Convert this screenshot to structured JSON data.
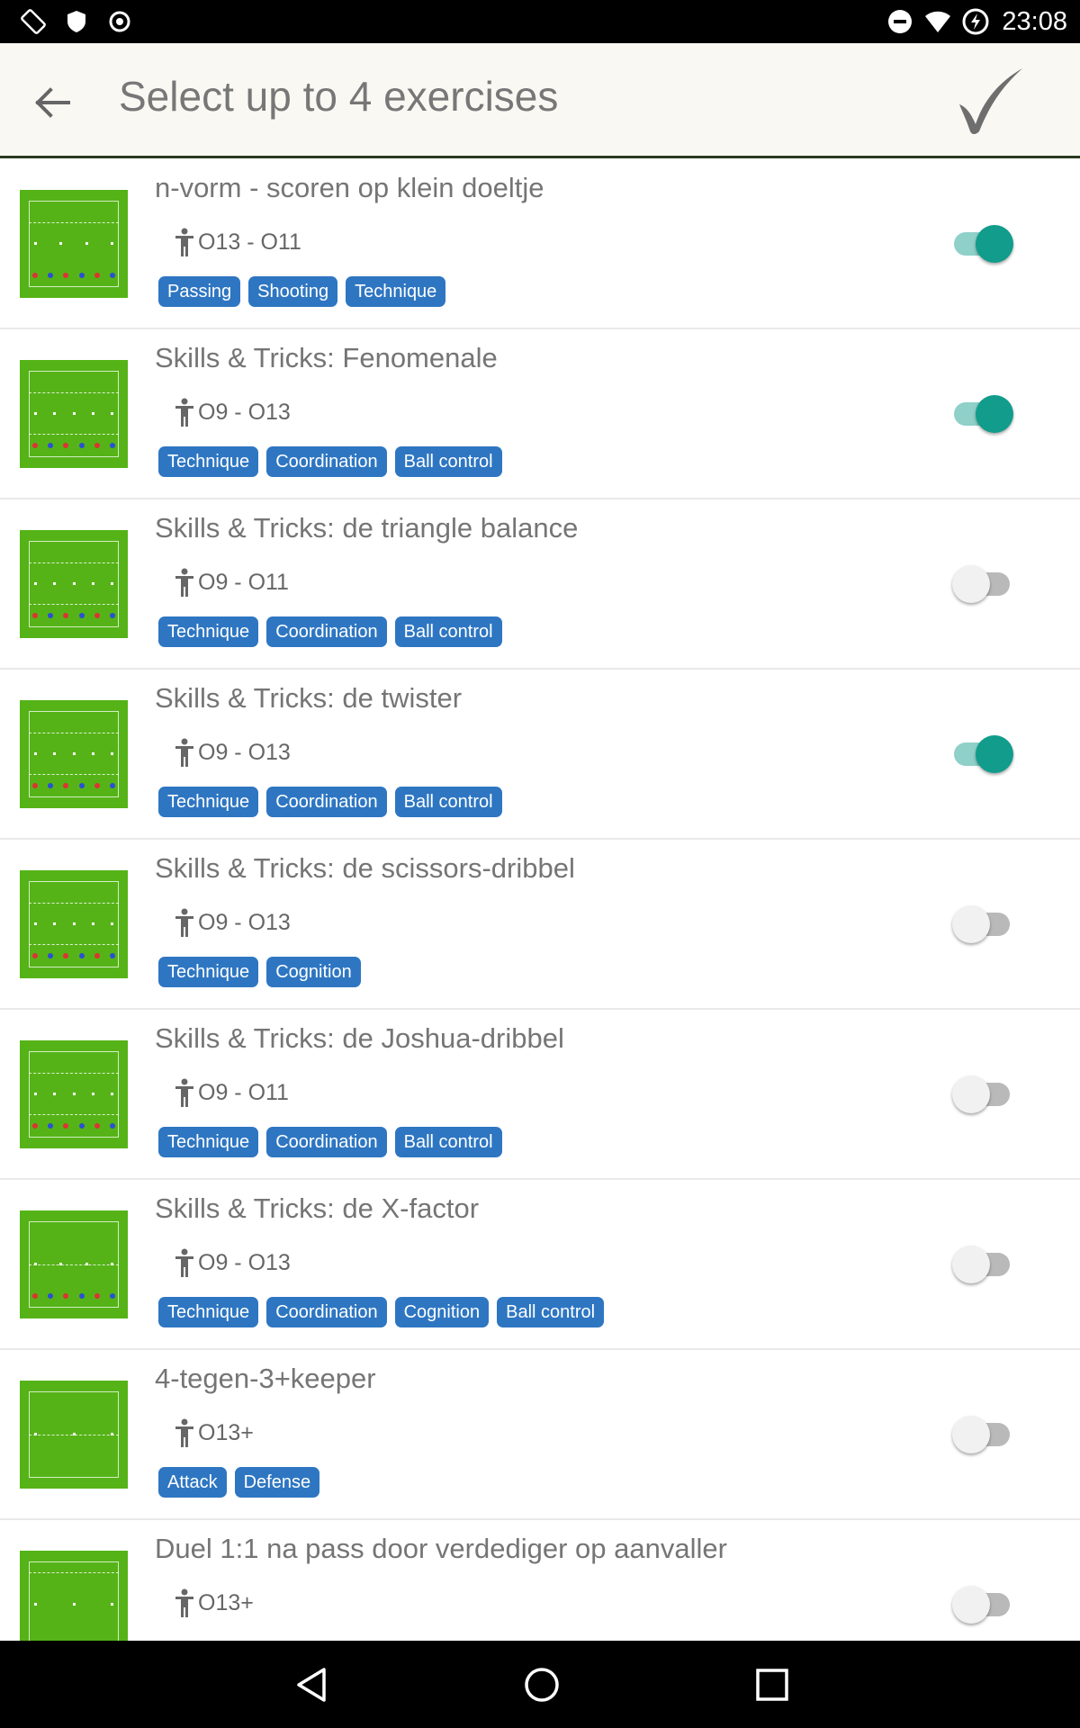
{
  "status_bar": {
    "time": "23:08",
    "icons": [
      "screen-rotation-icon",
      "shield-icon",
      "sync-icon",
      "do-not-disturb-icon",
      "wifi-icon",
      "battery-charging-icon"
    ]
  },
  "app_bar": {
    "title": "Select up to 4 exercises",
    "back_icon": "arrow-back-icon",
    "confirm_icon": "checkmark-icon"
  },
  "colors": {
    "toggle_on": "#119c8c",
    "tag_bg": "#2e76c2",
    "pitch_green": "#55b317"
  },
  "exercises": [
    {
      "title": "n-vorm - scoren op klein doeltje",
      "age": "O13 - O11",
      "tags": [
        "Passing",
        "Shooting",
        "Technique"
      ],
      "selected": true
    },
    {
      "title": "Skills & Tricks: Fenomenale",
      "age": "O9 - O13",
      "tags": [
        "Technique",
        "Coordination",
        "Ball control"
      ],
      "selected": true
    },
    {
      "title": "Skills & Tricks: de triangle balance",
      "age": "O9 - O11",
      "tags": [
        "Technique",
        "Coordination",
        "Ball control"
      ],
      "selected": false
    },
    {
      "title": "Skills & Tricks: de twister",
      "age": "O9 - O13",
      "tags": [
        "Technique",
        "Coordination",
        "Ball control"
      ],
      "selected": true
    },
    {
      "title": "Skills & Tricks: de scissors-dribbel",
      "age": "O9 - O13",
      "tags": [
        "Technique",
        "Cognition"
      ],
      "selected": false
    },
    {
      "title": "Skills & Tricks: de Joshua-dribbel",
      "age": "O9 - O11",
      "tags": [
        "Technique",
        "Coordination",
        "Ball control"
      ],
      "selected": false
    },
    {
      "title": "Skills & Tricks: de X-factor",
      "age": "O9 - O13",
      "tags": [
        "Technique",
        "Coordination",
        "Cognition",
        "Ball control"
      ],
      "selected": false
    },
    {
      "title": "4-tegen-3+keeper",
      "age": "O13+",
      "tags": [
        "Attack",
        "Defense"
      ],
      "selected": false
    },
    {
      "title": "Duel 1:1 na pass door verdediger op aanvaller",
      "age": "O13+",
      "tags": [],
      "selected": false
    }
  ],
  "nav_bar": {
    "icons": [
      "nav-back-icon",
      "nav-home-icon",
      "nav-recents-icon"
    ]
  }
}
